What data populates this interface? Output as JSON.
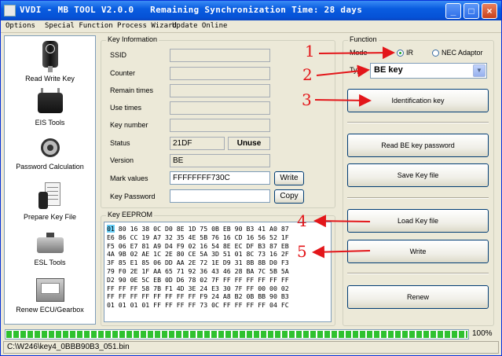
{
  "window": {
    "title": "VVDI - MB TOOL V2.0.0   Remaining Synchronization Time: 28 days"
  },
  "menu": [
    "Options",
    "Special Function",
    "Process Wizard",
    "Update Online"
  ],
  "nav": [
    {
      "label": "Read Write Key",
      "icon": "key-fob-icon"
    },
    {
      "label": "EIS Tools",
      "icon": "eis-module-icon"
    },
    {
      "label": "Password Calculation",
      "icon": "password-calc-icon"
    },
    {
      "label": "Prepare Key File",
      "icon": "key-file-icon"
    },
    {
      "label": "ESL Tools",
      "icon": "esl-module-icon"
    },
    {
      "label": "Renew ECU/Gearbox",
      "icon": "ecu-icon"
    }
  ],
  "key_info": {
    "group_title": "Key Information",
    "ssid_label": "SSID",
    "ssid": "",
    "counter_label": "Counter",
    "counter": "",
    "remain_label": "Remain times",
    "remain": "",
    "use_label": "Use times",
    "use": "",
    "keynum_label": "Key number",
    "keynum": "",
    "status_label": "Status",
    "status": "21DF",
    "status_button": "Unuse",
    "version_label": "Version",
    "version": "BE",
    "mark_label": "Mark values",
    "mark": "FFFFFFFF730C",
    "write_button": "Write",
    "password_label": "Key Password",
    "password": "",
    "copy_button": "Copy"
  },
  "eeprom": {
    "group_title": "Key EEPROM",
    "rows": [
      "01 80 16 38 0C D0 8E 1D 75 0B EB 90 B3 41 A0 87",
      "E6 86 CC 19 A7 32 35 4E 5B 76 16 CD 16 56 52 1F",
      "F5 06 E7 81 A9 D4 F9 02 16 54 8E EC DF B3 87 EB",
      "4A 9B 02 AE 1C 2E 80 CE 5A 3D 51 01 8C 73 16 2F",
      "3F 85 E1 85 06 DD AA 2E 72 1E D9 31 8B 8B D0 F3",
      "79 F0 2E 1F AA 65 71 92 36 43 46 28 BA 7C 5B 5A",
      "D2 90 0E 5C EB 0D D6 78 02 7F FF FF FF FF FF FF",
      "FF FF FF 58 7B F1 4D 3E 24 E3 30 7F FF 00 00 02",
      "FF FF FF FF FF FF FF FF F9 24 A8 B2 0B BB 90 B3",
      "01 01 01 01 FF FF FF FF 73 0C FF FF FF FF 04 FC"
    ]
  },
  "function": {
    "group_title": "Function",
    "mode_label": "Mode",
    "mode_options": [
      "IR",
      "NEC Adaptor"
    ],
    "mode_selected": "IR",
    "type_label": "Type",
    "type_value": "BE key",
    "buttons": {
      "identification": "Identification key",
      "read_password": "Read BE key password",
      "save_file": "Save Key file",
      "load_file": "Load Key file",
      "write": "Write",
      "renew": "Renew"
    }
  },
  "progress": {
    "value": 1.0,
    "text": "100%"
  },
  "status_bar": {
    "path": "C:\\W246\\key4_0BBB90B3_051.bin"
  },
  "annotations": [
    "1",
    "2",
    "3",
    "4",
    "5"
  ],
  "colors": {
    "annotation": "#e3161a",
    "progress": "#2fc12f",
    "titlebar": "#0551d6"
  }
}
